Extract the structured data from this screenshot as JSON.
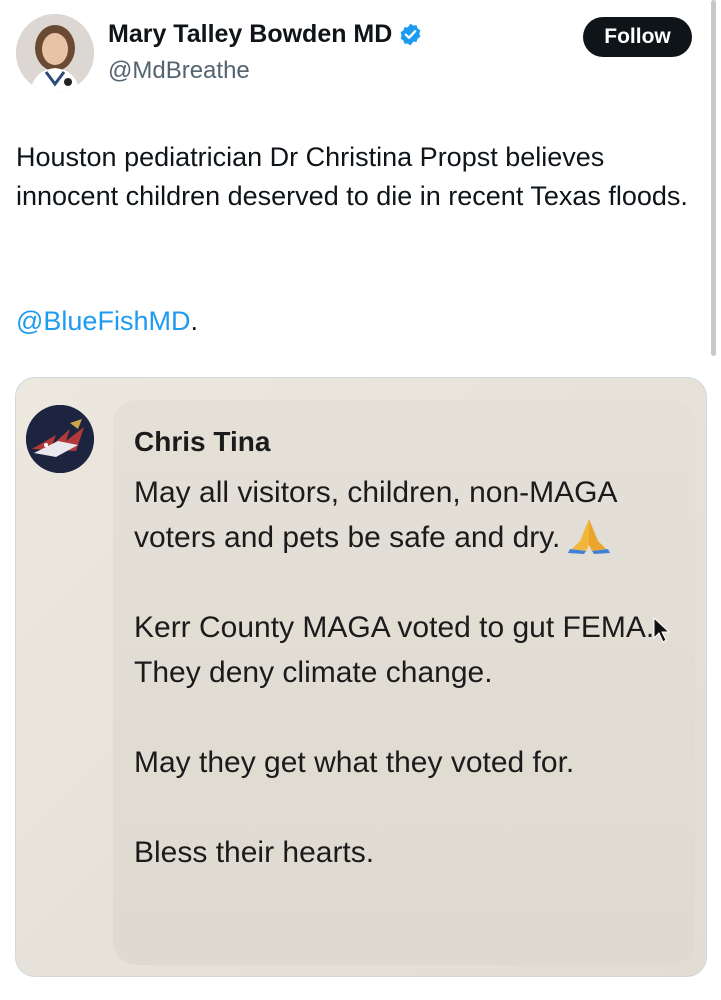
{
  "author": {
    "display_name": "Mary Talley Bowden MD",
    "handle": "@MdBreathe",
    "verified": true,
    "avatar_icon": "profile-photo"
  },
  "follow_label": "Follow",
  "tweet": {
    "text": "Houston pediatrician Dr Christina Propst believes innocent children deserved to die in recent Texas floods.",
    "mention": "@BlueFishMD",
    "mention_suffix": "."
  },
  "media": {
    "chat_author": "Chris Tina",
    "lines": [
      "May all visitors, children, non-MAGA voters and pets be safe and dry.",
      "Kerr County MAGA voted to gut FEMA.",
      "They deny climate change.",
      "May they get what they voted for.",
      "Bless their hearts."
    ],
    "emoji": "praying-hands-icon"
  },
  "colors": {
    "follow_bg": "#0f1419",
    "link": "#1d9bf0",
    "verified": "#1d9bf0",
    "handle": "#536471"
  }
}
